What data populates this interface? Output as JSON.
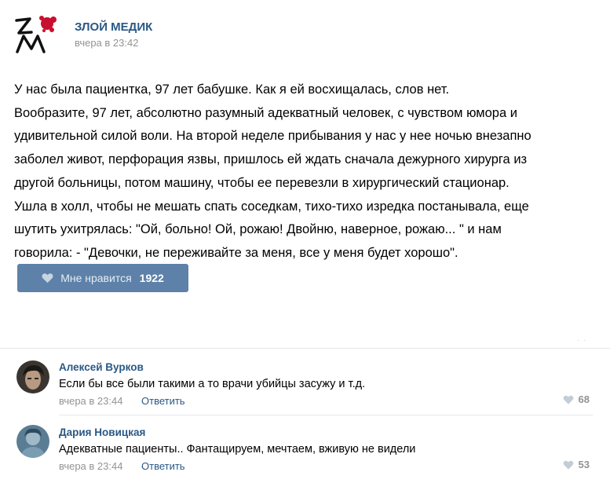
{
  "post": {
    "group_name": "ЗЛОЙ МЕДИК",
    "time": "вчера в 23:42",
    "text": "У нас была пациентка, 97 лет бабушке. Как я ей восхищалась, слов нет.\nВообразите, 97 лет, абсолютно разумный адекватный человек, с чувством юмора и\nудивительной силой воли. На второй неделе прибывания у нас у нее ночью внезапно\nзаболел живот, перфорация язвы, пришлось ей ждать сначала дежурного хирурга из\nдругой больницы, потом машину, чтобы ее перевезли в хирургический стационар.\nУшла в холл, чтобы не мешать спать соседкам, тихо-тихо изредка постанывала, еще\nшутить ухитрялась: \"Ой, больно! Ой, рожаю! Двойню, наверное, рожаю... \" и нам\nговорила: - \"Девочки, не переживайте за меня, все у меня будет хорошо\".",
    "like_label": "Мне нравится",
    "like_count": "1922"
  },
  "comments": [
    {
      "author": "Алексей Вурков",
      "text": "Если бы все были такими а то врачи убийцы засужу и т.д.",
      "time": "вчера в 23:44",
      "reply_label": "Ответить",
      "likes": "68"
    },
    {
      "author": "Дария Новицкая",
      "text": "Адекватные пациенты.. Фантащируем, мечтаем, вживую не видели",
      "time": "вчера в 23:44",
      "reply_label": "Ответить",
      "likes": "53"
    }
  ],
  "icons": {
    "like": "heart-icon",
    "group_logo": "zm-logo-icon"
  },
  "colors": {
    "link": "#2a5885",
    "like_button": "#5d81a8",
    "muted": "#939393",
    "logo_accent": "#c8102e"
  }
}
